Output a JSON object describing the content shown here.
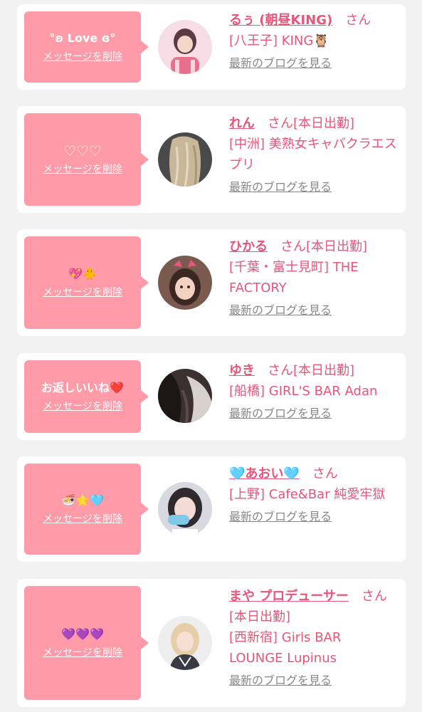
{
  "colors": {
    "accent": "#e8557a",
    "bubble": "#ff9aa8",
    "muted": "#888888",
    "background": "#f2f2f2"
  },
  "cards": [
    {
      "message": "°ʚ Love ɞ°",
      "delete_label": "メッセージを削除",
      "name": "るぅ (朝昼KING)",
      "suffix": "　さん",
      "shop": "[八王子] KING🦉",
      "blog_label": "最新のブログを見る",
      "avatar_icon": "avatar-girl-pink"
    },
    {
      "message": "♡♡♡",
      "delete_label": "メッセージを削除",
      "name": "れん",
      "suffix": "　さん[本日出勤]",
      "shop": "[中洲] 美熟女キャバクラエスプリ",
      "blog_label": "最新のブログを見る",
      "avatar_icon": "avatar-hair-blonde"
    },
    {
      "message": "💖🐥",
      "delete_label": "メッセージを削除",
      "name": "ひかる",
      "suffix": "　さん[本日出勤]",
      "shop": "[千葉・富士見町] THE FACTORY",
      "blog_label": "最新のブログを見る",
      "avatar_icon": "avatar-girl-ribbon"
    },
    {
      "message": "お返しいいね❤️",
      "delete_label": "メッセージを削除",
      "name": "ゆき",
      "suffix": "　さん[本日出勤]",
      "shop": "[船橋] GIRL'S BAR Adan",
      "blog_label": "最新のブログを見る",
      "avatar_icon": "avatar-dark-hair"
    },
    {
      "message": "🍜🌟🩵",
      "delete_label": "メッセージを削除",
      "name": "🩵あおい🩵",
      "suffix": "　さん",
      "shop": "[上野] Cafe&Bar 純愛牢獄",
      "blog_label": "最新のブログを見る",
      "avatar_icon": "avatar-girl-secret"
    },
    {
      "message": "💜💜💜",
      "delete_label": "メッセージを削除",
      "name": "まや プロデューサー",
      "suffix": "　さん[本日出勤]",
      "shop": "[西新宿] Girls BAR LOUNGE Lupinus",
      "blog_label": "最新のブログを見る",
      "avatar_icon": "avatar-girl-blonde"
    }
  ]
}
